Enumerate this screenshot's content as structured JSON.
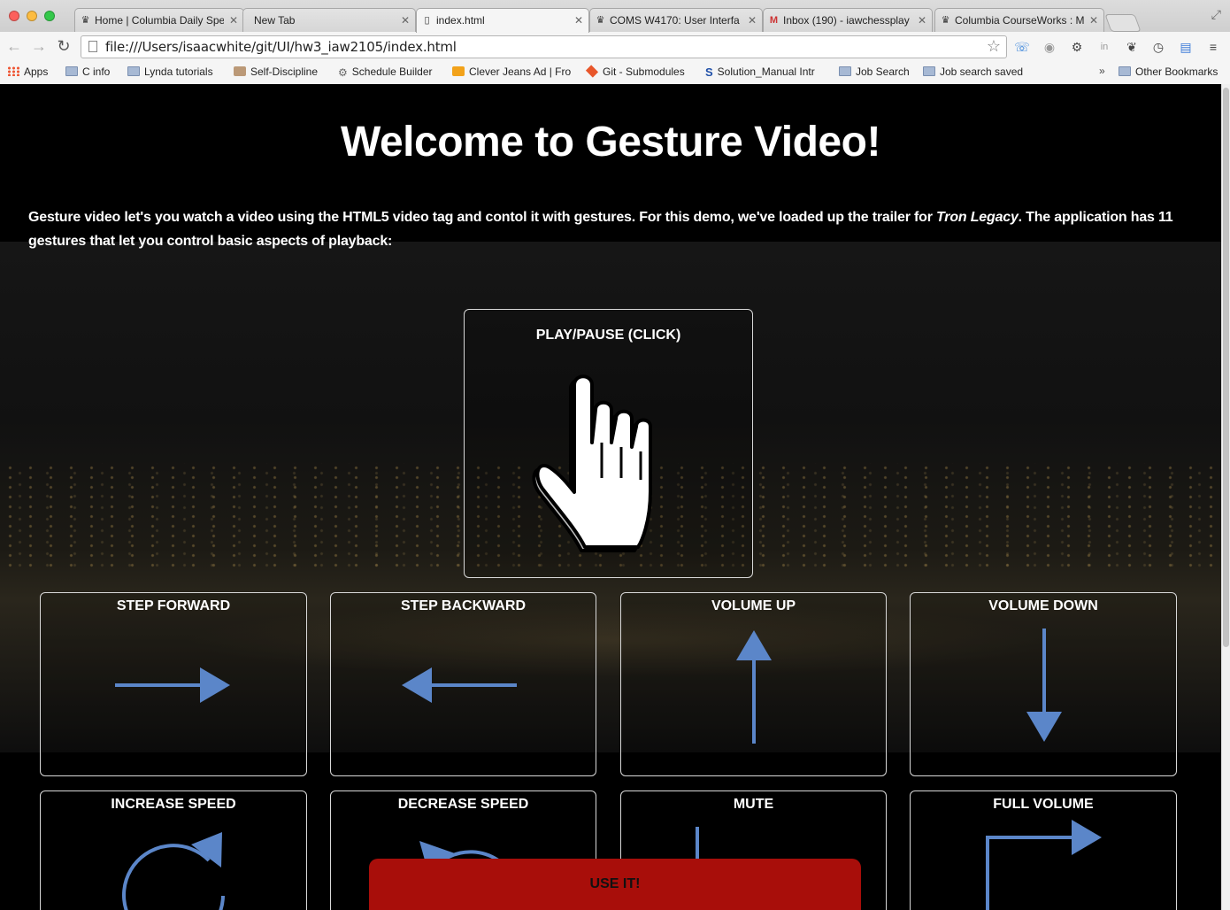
{
  "browser": {
    "tabs": [
      {
        "label": "Home | Columbia Daily Spe",
        "icon": "crown-icon"
      },
      {
        "label": "New Tab",
        "icon": ""
      },
      {
        "label": "index.html",
        "icon": "page-icon",
        "active": true
      },
      {
        "label": "COMS W4170: User Interfa",
        "icon": "crown-icon"
      },
      {
        "label": "Inbox (190) - iawchessplay",
        "icon": "gmail-icon"
      },
      {
        "label": "Columbia CourseWorks : M",
        "icon": "crown-icon"
      }
    ],
    "url": "file:///Users/isaacwhite/git/UI/hw3_iaw2105/index.html",
    "bookmarks": [
      {
        "label": "Apps",
        "icon": "apps-grid-icon"
      },
      {
        "label": "C info",
        "icon": "folder-icon"
      },
      {
        "label": "Lynda tutorials",
        "icon": "folder-icon"
      },
      {
        "label": "Self-Discipline",
        "icon": "person-icon"
      },
      {
        "label": "Schedule Builder",
        "icon": "gear-icon"
      },
      {
        "label": "Clever Jeans Ad | Fro",
        "icon": "site-icon"
      },
      {
        "label": "Git - Submodules",
        "icon": "git-icon"
      },
      {
        "label": "Solution_Manual Intr",
        "icon": "s-icon"
      },
      {
        "label": "Job Search",
        "icon": "folder-icon"
      },
      {
        "label": "Job search saved",
        "icon": "folder-icon"
      }
    ],
    "bookmarks_more": "»",
    "other_bookmarks": "Other Bookmarks"
  },
  "page": {
    "title": "Welcome to Gesture Video!",
    "intro_before": "Gesture video let's you watch a video using the HTML5 video tag and contol it with gestures. For this demo, we've loaded up the trailer for ",
    "intro_movie": "Tron Legacy",
    "intro_after": ". The application has 11 gestures that let you control basic aspects of playback:",
    "gestures": {
      "play_pause": {
        "label": "PLAY/PAUSE (CLICK)",
        "icon": "hand-pointer-icon"
      },
      "step_forward": {
        "label": "STEP FORWARD",
        "icon": "arrow-right-icon"
      },
      "step_backward": {
        "label": "STEP BACKWARD",
        "icon": "arrow-left-icon"
      },
      "volume_up": {
        "label": "VOLUME UP",
        "icon": "arrow-up-icon"
      },
      "volume_down": {
        "label": "VOLUME DOWN",
        "icon": "arrow-down-icon"
      },
      "increase_speed": {
        "label": "INCREASE SPEED",
        "icon": "circle-arrow-clockwise-icon"
      },
      "decrease_speed": {
        "label": "DECREASE SPEED",
        "icon": "circle-arrow-counterclockwise-icon"
      },
      "mute": {
        "label": "MUTE",
        "icon": "line-down-icon"
      },
      "full_volume": {
        "label": "FULL VOLUME",
        "icon": "corner-arrow-right-icon"
      }
    },
    "use_it_label": "USE IT!",
    "arrow_color": "#5b86c9",
    "button_color": "#a80e0a"
  }
}
